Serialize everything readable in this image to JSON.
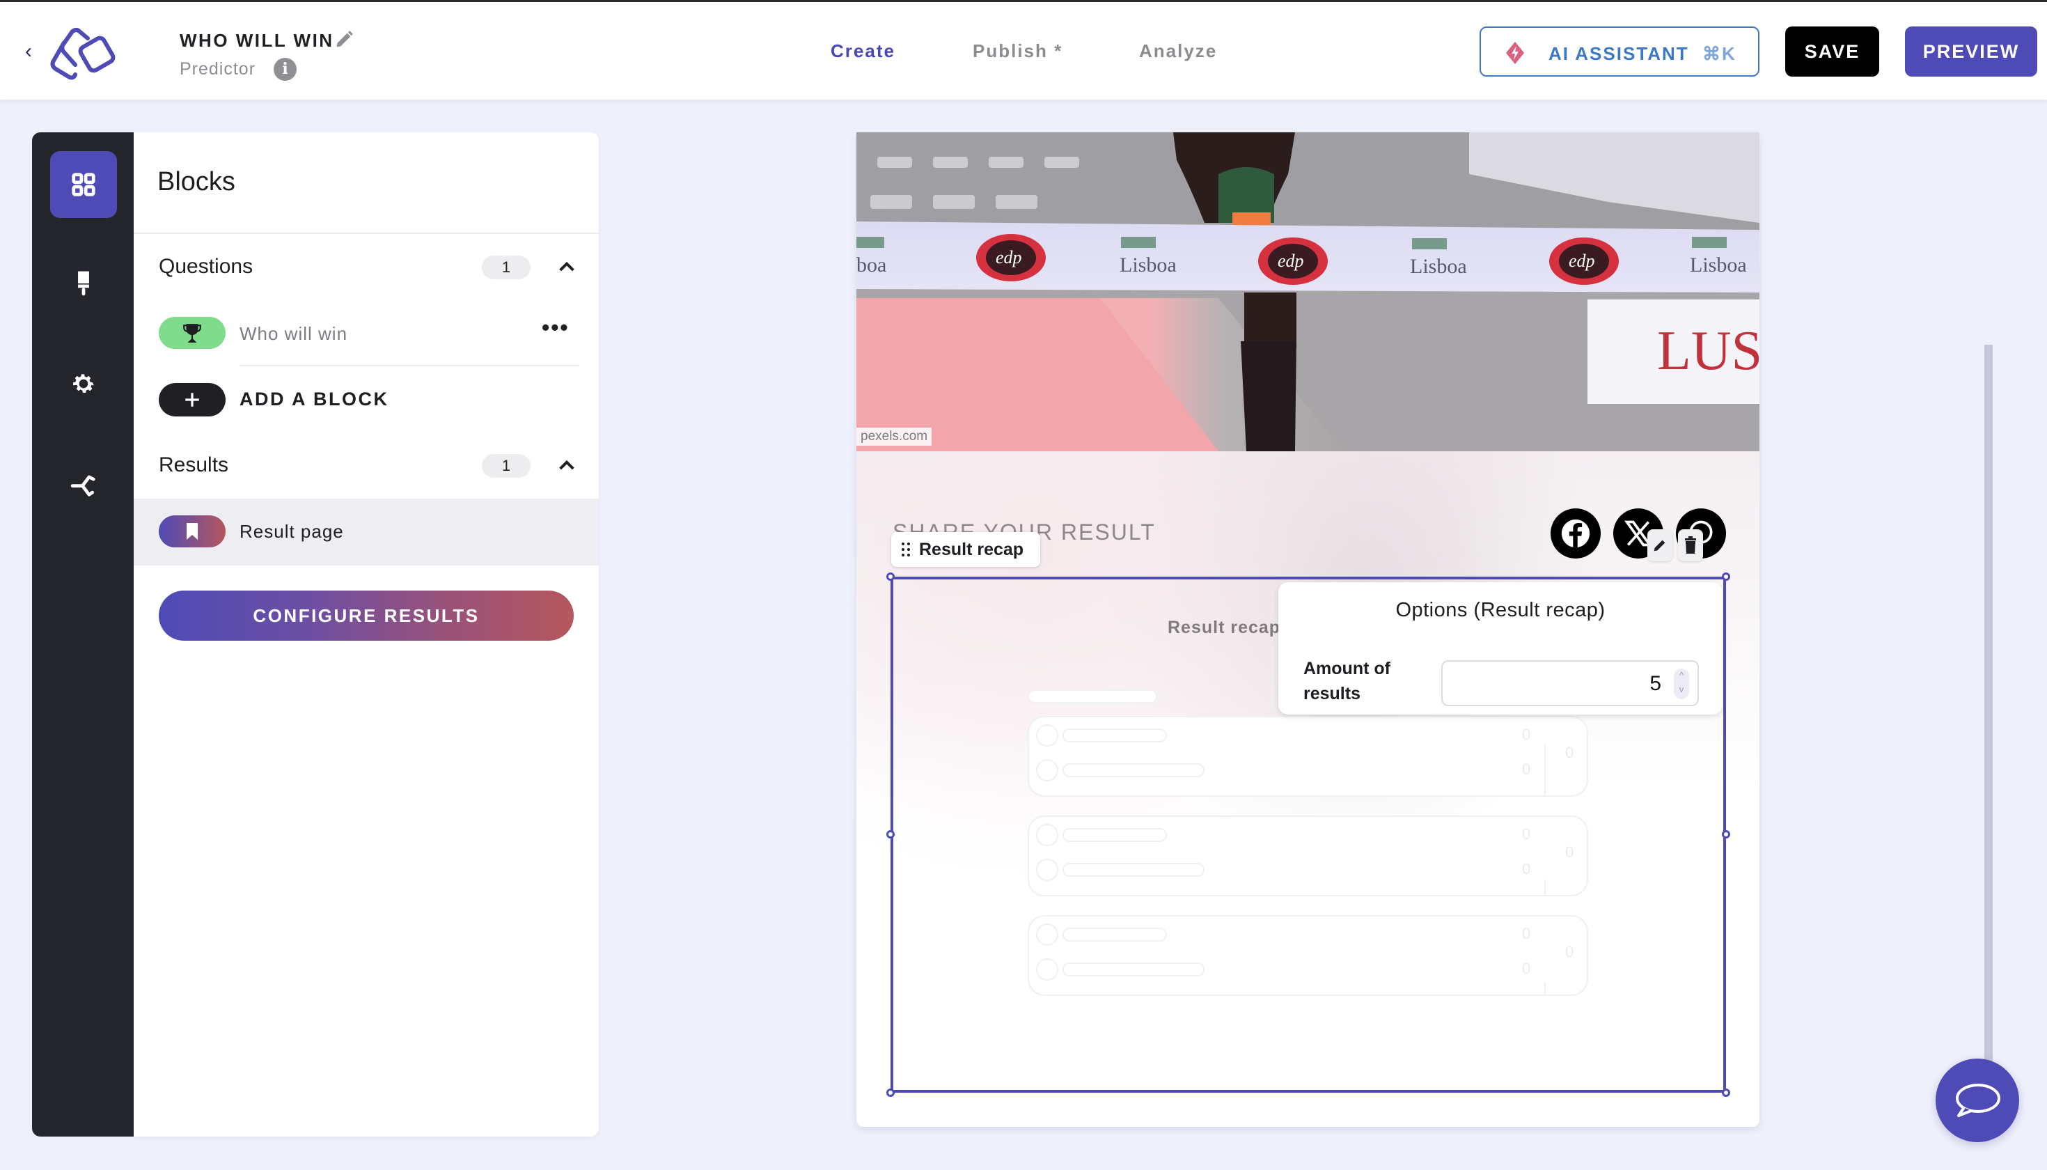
{
  "header": {
    "project_title": "WHO WILL WIN",
    "project_type": "Predictor",
    "info_glyph": "i",
    "tabs": [
      {
        "label": "Create",
        "active": true
      },
      {
        "label": "Publish *",
        "active": false
      },
      {
        "label": "Analyze",
        "active": false
      }
    ],
    "ai_assistant_label": "AI ASSISTANT",
    "ai_assistant_shortcut": "⌘K",
    "save_label": "SAVE",
    "preview_label": "PREVIEW"
  },
  "rail": {
    "items": [
      {
        "icon": "blocks-grid-icon",
        "active": true
      },
      {
        "icon": "paintbrush-icon",
        "active": false
      },
      {
        "icon": "gear-icon",
        "active": false
      },
      {
        "icon": "branch-icon",
        "active": false
      }
    ]
  },
  "panel": {
    "title": "Blocks",
    "questions": {
      "title": "Questions",
      "count": "1",
      "items": [
        {
          "label": "Who will win",
          "icon": "trophy-icon",
          "more_glyph": "•••"
        }
      ]
    },
    "add_block_label": "ADD A BLOCK",
    "results": {
      "title": "Results",
      "count": "1",
      "items": [
        {
          "label": "Result page",
          "icon": "bookmark-icon"
        }
      ]
    },
    "configure_results_label": "CONFIGURE RESULTS"
  },
  "canvas": {
    "image_credit": "pexels.com",
    "share_title": "SHARE YOUR RESULT",
    "block_tag_label": "Result recap",
    "block_center_label": "Result recap",
    "skeleton_number": "0",
    "options": {
      "title": "Options (Result recap)",
      "field_label": "Amount of results",
      "field_value": "5",
      "spinner_up": "^",
      "spinner_down": "v"
    }
  },
  "colors": {
    "accent": "#4e4bb6",
    "ai_blue": "#3d78c4",
    "rail_bg": "#25262c",
    "page_bg": "#eef0fb",
    "question_pill": "#7fdc8c"
  }
}
